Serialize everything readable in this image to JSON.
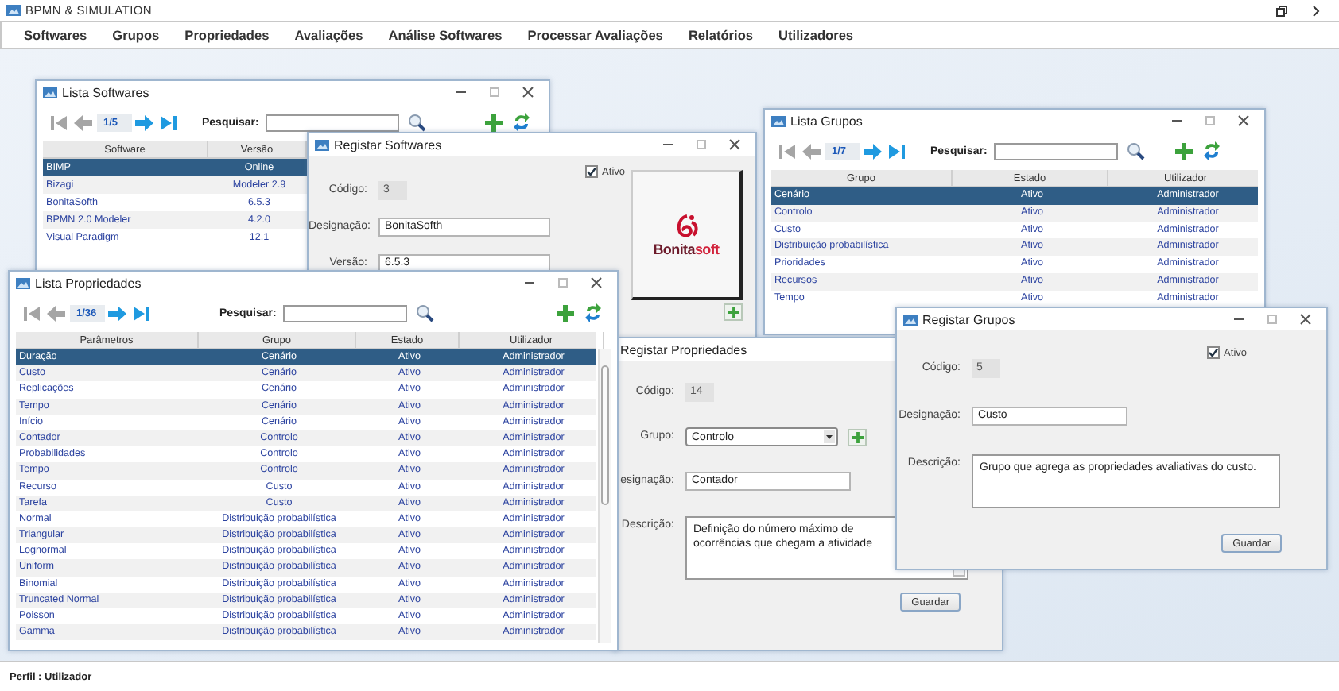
{
  "app": {
    "title": "BPMN & SIMULATION"
  },
  "menu": [
    "Softwares",
    "Grupos",
    "Propriedades",
    "Avaliações",
    "Análise Softwares",
    "Processar Avaliações",
    "Relatórios",
    "Utilizadores"
  ],
  "lista_softwares": {
    "title": "Lista Softwares",
    "pager": "1/5",
    "search_label": "Pesquisar:",
    "columns": [
      "Software",
      "Versão"
    ],
    "rows": [
      {
        "cells": [
          "BIMP",
          "Online"
        ],
        "selected": true
      },
      {
        "cells": [
          "Bizagi",
          "Modeler 2.9"
        ],
        "selected": false
      },
      {
        "cells": [
          "BonitaSofth",
          "6.5.3"
        ],
        "selected": false
      },
      {
        "cells": [
          "BPMN 2.0 Modeler",
          "4.2.0"
        ],
        "selected": false
      },
      {
        "cells": [
          "Visual Paradigm",
          "12.1"
        ],
        "selected": false
      }
    ]
  },
  "registar_softwares": {
    "title": "Registar Softwares",
    "fields": [
      {
        "kind": "readonly",
        "label": "Código:",
        "value": "3"
      },
      {
        "kind": "text",
        "label": "Designação:",
        "value": "BonitaSofth"
      },
      {
        "kind": "text",
        "label": "Versão:",
        "value": "6.5.3"
      }
    ],
    "active": {
      "label": "Ativo",
      "checked": true
    },
    "logo_text": [
      "Bonita",
      "soft"
    ]
  },
  "lista_grupos": {
    "title": "Lista Grupos",
    "pager": "1/7",
    "search_label": "Pesquisar:",
    "columns": [
      "Grupo",
      "Estado",
      "Utilizador"
    ],
    "rows": [
      {
        "cells": [
          "Cenário",
          "Ativo",
          "Administrador"
        ],
        "selected": true
      },
      {
        "cells": [
          "Controlo",
          "Ativo",
          "Administrador"
        ],
        "selected": false
      },
      {
        "cells": [
          "Custo",
          "Ativo",
          "Administrador"
        ],
        "selected": false
      },
      {
        "cells": [
          "Distribuição probabilística",
          "Ativo",
          "Administrador"
        ],
        "selected": false
      },
      {
        "cells": [
          "Prioridades",
          "Ativo",
          "Administrador"
        ],
        "selected": false
      },
      {
        "cells": [
          "Recursos",
          "Ativo",
          "Administrador"
        ],
        "selected": false
      },
      {
        "cells": [
          "Tempo",
          "Ativo",
          "Administrador"
        ],
        "selected": false
      }
    ]
  },
  "registar_propriedades": {
    "title": "Registar Propriedades",
    "fields": [
      {
        "kind": "readonly",
        "label": "Código:",
        "value": "14"
      },
      {
        "kind": "select",
        "label": "Grupo:",
        "value": "Controlo"
      },
      {
        "kind": "text",
        "label": "esignação:",
        "value": "Contador"
      },
      {
        "kind": "textarea",
        "label": "Descrição:",
        "value": "Definição do número máximo de ocorrências que chegam a atividade"
      }
    ],
    "button": "Guardar"
  },
  "lista_propriedades": {
    "title": "Lista Propriedades",
    "pager": "1/36",
    "search_label": "Pesquisar:",
    "columns": [
      "Parâmetros",
      "Grupo",
      "Estado",
      "Utilizador"
    ],
    "rows": [
      {
        "cells": [
          "Duração",
          "Cenário",
          "Ativo",
          "Administrador"
        ],
        "selected": true
      },
      {
        "cells": [
          "Custo",
          "Cenário",
          "Ativo",
          "Administrador"
        ],
        "selected": false
      },
      {
        "cells": [
          "Replicações",
          "Cenário",
          "Ativo",
          "Administrador"
        ],
        "selected": false
      },
      {
        "cells": [
          "Tempo",
          "Cenário",
          "Ativo",
          "Administrador"
        ],
        "selected": false
      },
      {
        "cells": [
          "Início",
          "Cenário",
          "Ativo",
          "Administrador"
        ],
        "selected": false
      },
      {
        "cells": [
          "Contador",
          "Controlo",
          "Ativo",
          "Administrador"
        ],
        "selected": false
      },
      {
        "cells": [
          "Probabilidades",
          "Controlo",
          "Ativo",
          "Administrador"
        ],
        "selected": false
      },
      {
        "cells": [
          "Tempo",
          "Controlo",
          "Ativo",
          "Administrador"
        ],
        "selected": false
      },
      {
        "cells": [
          "Recurso",
          "Custo",
          "Ativo",
          "Administrador"
        ],
        "selected": false
      },
      {
        "cells": [
          "Tarefa",
          "Custo",
          "Ativo",
          "Administrador"
        ],
        "selected": false
      },
      {
        "cells": [
          "Normal",
          "Distribuição probabilística",
          "Ativo",
          "Administrador"
        ],
        "selected": false
      },
      {
        "cells": [
          "Triangular",
          "Distribuição probabilística",
          "Ativo",
          "Administrador"
        ],
        "selected": false
      },
      {
        "cells": [
          "Lognormal",
          "Distribuição probabilística",
          "Ativo",
          "Administrador"
        ],
        "selected": false
      },
      {
        "cells": [
          "Uniform",
          "Distribuição probabilística",
          "Ativo",
          "Administrador"
        ],
        "selected": false
      },
      {
        "cells": [
          "Binomial",
          "Distribuição probabilística",
          "Ativo",
          "Administrador"
        ],
        "selected": false
      },
      {
        "cells": [
          "Truncated Normal",
          "Distribuição probabilística",
          "Ativo",
          "Administrador"
        ],
        "selected": false
      },
      {
        "cells": [
          "Poisson",
          "Distribuição probabilística",
          "Ativo",
          "Administrador"
        ],
        "selected": false
      },
      {
        "cells": [
          "Gamma",
          "Distribuição probabilística",
          "Ativo",
          "Administrador"
        ],
        "selected": false
      }
    ]
  },
  "registar_grupos": {
    "title": "Registar Grupos",
    "fields": [
      {
        "kind": "readonly",
        "label": "Código:",
        "value": "5"
      },
      {
        "kind": "text",
        "label": "Designação:",
        "value": "Custo"
      },
      {
        "kind": "textarea",
        "label": "Descrição:",
        "value": "Grupo que agrega as propriedades avaliativas do custo."
      }
    ],
    "active": {
      "label": "Ativo",
      "checked": true
    },
    "button": "Guardar"
  },
  "status_bar": {
    "label": "Perfil : Utilizador"
  }
}
